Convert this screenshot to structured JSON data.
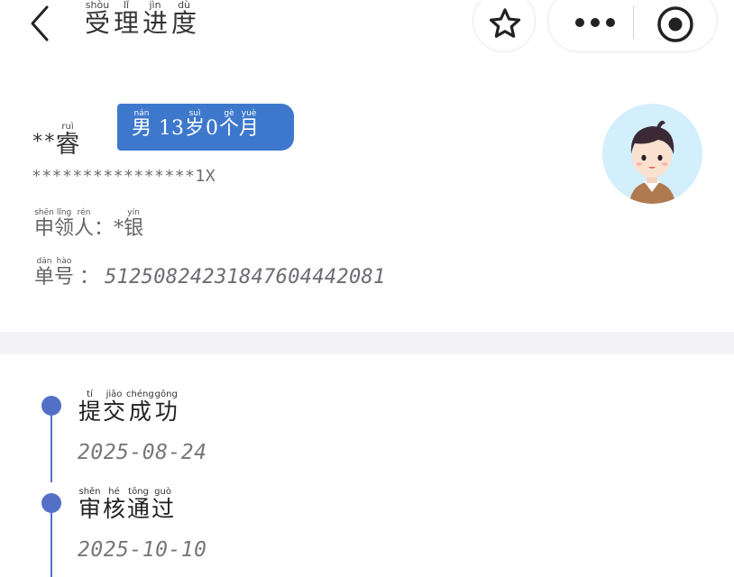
{
  "header": {
    "title": [
      {
        "char": "受",
        "pinyin": "shòu"
      },
      {
        "char": "理",
        "pinyin": "lǐ"
      },
      {
        "char": "进",
        "pinyin": "jìn"
      },
      {
        "char": "度",
        "pinyin": "dù"
      }
    ],
    "icons": {
      "back": "chevron-left-icon",
      "favorite": "star-icon",
      "more": "more-dots-icon",
      "close": "target-icon"
    }
  },
  "profile": {
    "name_mask": "**",
    "name_char": {
      "char": "睿",
      "pinyin": "ruì"
    },
    "badge": {
      "gender": {
        "char": "男",
        "pinyin": "nán"
      },
      "age_number": "13",
      "age_unit": {
        "char": "岁",
        "pinyin": "suì"
      },
      "months_number": "0",
      "months_measure": {
        "char": "个",
        "pinyin": "gè"
      },
      "months_unit": {
        "char": "月",
        "pinyin": "yuè"
      },
      "color": "#3d78cc"
    },
    "id_number": "****************1X",
    "applicant": {
      "label": [
        {
          "char": "申",
          "pinyin": "shēn"
        },
        {
          "char": "领",
          "pinyin": "lǐng"
        },
        {
          "char": "人",
          "pinyin": "rén"
        }
      ],
      "colon": "：",
      "name_mask": "*",
      "name_char": {
        "char": "银",
        "pinyin": "yín"
      }
    },
    "order": {
      "label": [
        {
          "char": "单",
          "pinyin": "dān"
        },
        {
          "char": "号",
          "pinyin": "hào"
        }
      ],
      "colon": "：",
      "number": "51250824231847604442081"
    },
    "avatar_icon": "boy-avatar-icon"
  },
  "timeline": {
    "accent": "#5470c6",
    "items": [
      {
        "title": [
          {
            "char": "提",
            "pinyin": "tí"
          },
          {
            "char": "交",
            "pinyin": "jiāo"
          },
          {
            "char": "成",
            "pinyin": "chéng"
          },
          {
            "char": "功",
            "pinyin": "gōng"
          }
        ],
        "date": "2025-08-24"
      },
      {
        "title": [
          {
            "char": "审",
            "pinyin": "shěn"
          },
          {
            "char": "核",
            "pinyin": "hé"
          },
          {
            "char": "通",
            "pinyin": "tōng"
          },
          {
            "char": "过",
            "pinyin": "guò"
          }
        ],
        "date": "2025-10-10"
      }
    ]
  }
}
